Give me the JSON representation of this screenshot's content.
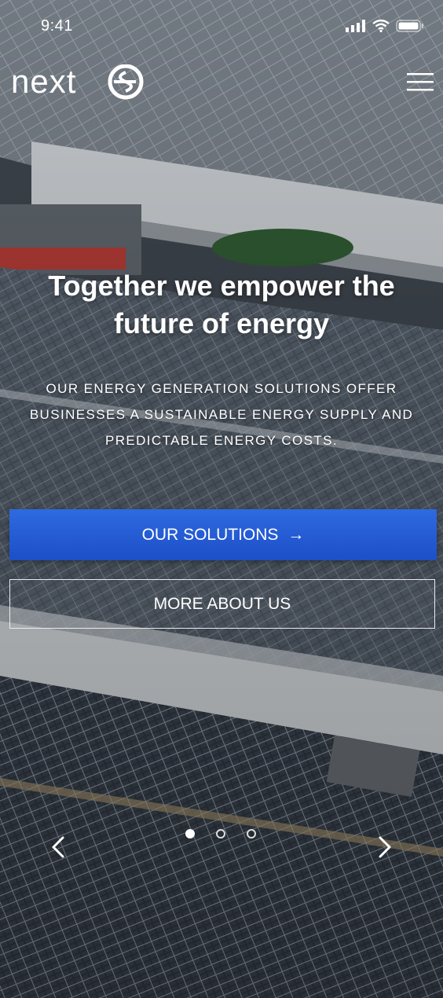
{
  "status_bar": {
    "time": "9:41",
    "icons": [
      "signal-icon",
      "wifi-icon",
      "battery-icon"
    ]
  },
  "header": {
    "logo_text": "next",
    "menu_icon": "hamburger-menu-icon"
  },
  "hero": {
    "headline_line1": "Together we empower the",
    "headline_line2": "future of energy",
    "sub_line1": "OUR ENERGY GENERATION SOLUTIONS OFFER",
    "sub_line2": "BUSINESSES A SUSTAINABLE ENERGY SUPPLY AND",
    "sub_line3": "PREDICTABLE ENERGY COSTS.",
    "primary_button": "OUR SOLUTIONS",
    "primary_button_icon": "→",
    "secondary_button": "MORE ABOUT US"
  },
  "carousel": {
    "slide_count": 3,
    "active_index": 0,
    "prev_icon": "chevron-left-icon",
    "next_icon": "chevron-right-icon"
  },
  "colors": {
    "primary_button": "#2459d3",
    "text": "#ffffff"
  }
}
